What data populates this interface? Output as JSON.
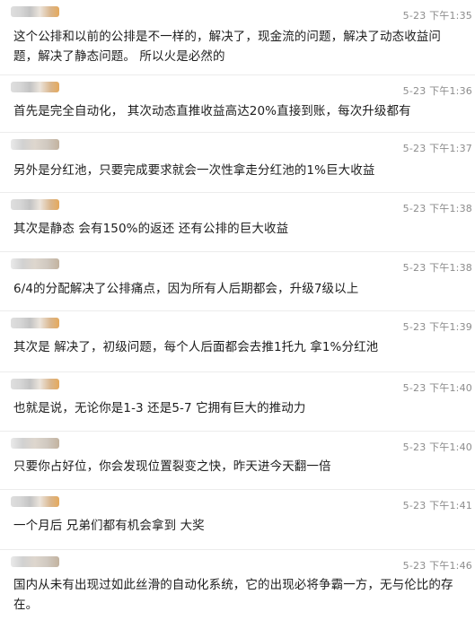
{
  "messages": [
    {
      "time": "5-23 下午1:35",
      "text": "这个公排和以前的公排是不一样的，解决了，现金流的问题，解决了动态收益问题，解决了静态问题。 所以火是必然的"
    },
    {
      "time": "5-23 下午1:36",
      "text": "首先是完全自动化， 其次动态直推收益高达20%直接到账，每次升级都有"
    },
    {
      "time": "5-23 下午1:37",
      "text": "另外是分红池，只要完成要求就会一次性拿走分红池的1%巨大收益"
    },
    {
      "time": "5-23 下午1:38",
      "text": "其次是静态 会有150%的返还 还有公排的巨大收益"
    },
    {
      "time": "5-23 下午1:38",
      "text": "6/4的分配解决了公排痛点，因为所有人后期都会，升级7级以上"
    },
    {
      "time": "5-23 下午1:39",
      "text": "其次是 解决了，初级问题，每个人后面都会去推1托九 拿1%分红池"
    },
    {
      "time": "5-23 下午1:40",
      "text": "也就是说，无论你是1-3 还是5-7 它拥有巨大的推动力"
    },
    {
      "time": "5-23 下午1:40",
      "text": "只要你占好位，你会发现位置裂变之快，昨天进今天翻一倍"
    },
    {
      "time": "5-23 下午1:41",
      "text": "一个月后 兄弟们都有机会拿到 大奖"
    },
    {
      "time": "5-23 下午1:46",
      "text": "国内从未有出现过如此丝滑的自动化系统，它的出现必将争霸一方，无与伦比的存在。"
    }
  ]
}
